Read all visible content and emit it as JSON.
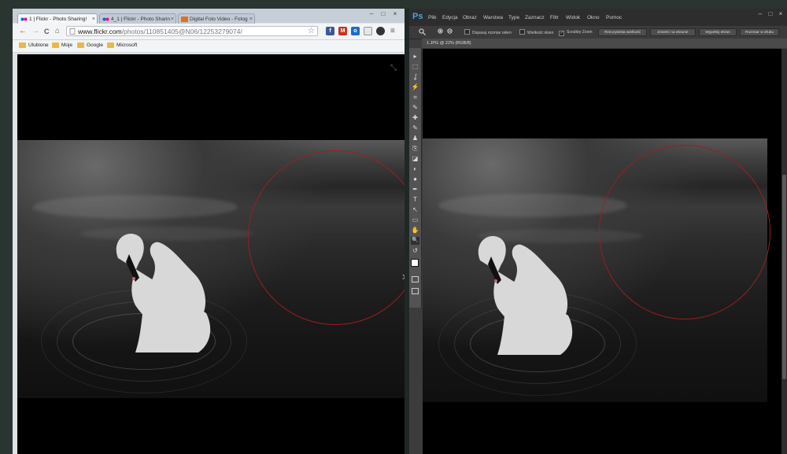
{
  "chrome": {
    "tabs": [
      {
        "label": "1 | Flickr - Photo Sharing!",
        "close": "×"
      },
      {
        "label": "4_1 | Flickr - Photo Sharin",
        "close": "×"
      },
      {
        "label": "Digital Foto Video - Fotog",
        "close": "×"
      }
    ],
    "window_controls": {
      "minimize": "–",
      "maximize": "□",
      "close": "×"
    },
    "nav": {
      "back": "←",
      "forward": "→",
      "reload": "C",
      "home": "⌂"
    },
    "url_host": "www.flickr.com",
    "url_path": "/photos/110851405@N06/12253279074/",
    "star": "☆",
    "bookmarks": [
      "Ulubione",
      "Moje",
      "Google",
      "Microsoft"
    ],
    "next_arrow": "›",
    "expand_icon": "⤡"
  },
  "photoshop": {
    "logo": "Ps",
    "menu": [
      "Plik",
      "Edycja",
      "Obraz",
      "Warstwa",
      "Type",
      "Zaznacz",
      "Filtr",
      "Widok",
      "Okno",
      "Pomoc"
    ],
    "options": {
      "fit_windows": "Dopasuj rozmiar okien",
      "all_windows": "Wielkość okien",
      "scrubby_zoom": "Scrubby Zoom",
      "actual_pixels": "Rzeczywista wielkość",
      "fit_screen": "Zmieść na ekranie",
      "fill_screen": "Wypełnij ekran",
      "print_size": "Rozmiar w druku"
    },
    "document_title": "1.JPG @ 22% (RGB/8)",
    "tools": [
      "▸",
      "⬚",
      "ʆ",
      "⚡",
      "⌗",
      "✎",
      "✚",
      "✎",
      "♟",
      "⎘",
      "◪",
      "◐",
      "●",
      "✒",
      "T",
      "↖",
      "▭",
      "✋",
      "🔍",
      "↺"
    ],
    "window_controls": {
      "minimize": "–",
      "maximize": "□",
      "close": "×"
    }
  }
}
